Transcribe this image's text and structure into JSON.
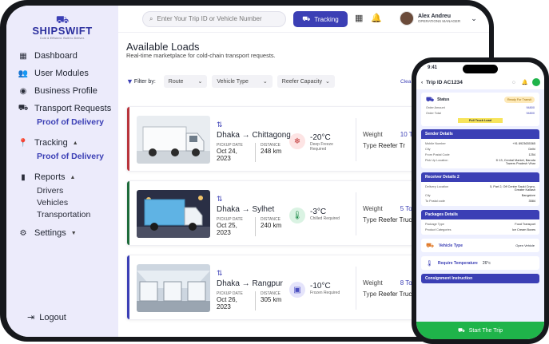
{
  "brand": {
    "name": "SHIPSWIFT",
    "tagline": "Cold & Efficient. Built to Deliver."
  },
  "sidebar": {
    "items": [
      {
        "label": "Dashboard"
      },
      {
        "label": "User Modules"
      },
      {
        "label": "Business Profile"
      },
      {
        "label": "Transport Requests"
      },
      {
        "label": "Tracking"
      },
      {
        "label": "Reports"
      },
      {
        "label": "Settings"
      }
    ],
    "transport_sub": "Proof of Delivery",
    "tracking_sub": "Proof of Delivery",
    "reports_subs": [
      "Drivers",
      "Vehicles",
      "Transportation"
    ],
    "logout": "Logout"
  },
  "header": {
    "search_placeholder": "Enter Your Trip ID or Vehicle Number",
    "tracking_label": "Tracking",
    "user_name": "Alex Andreu",
    "user_role": "OPERATIONS MANAGER"
  },
  "page": {
    "title": "Available Loads",
    "subtitle": "Real-time marketplace for cold-chain transport requests."
  },
  "filters": {
    "label": "Filter by:",
    "route": "Route",
    "vehicle_type": "Vehicle Type",
    "reefer": "Reefer Capacity",
    "clear": "Clea"
  },
  "loads": [
    {
      "from": "Dhaka",
      "to": "Chittagong",
      "pickup_label": "PICKUP DATE",
      "pickup": "Oct 24, 2023",
      "distance_label": "DISTANCE",
      "distance": "248 km",
      "temp": "-20°C",
      "temp_label": "Deep Freeze Required",
      "weight_label": "Weight",
      "weight": "10 T",
      "type_label": "Type",
      "type": "Reefer Tr",
      "accent": "#b8343b",
      "temp_bg": "#fde4e4",
      "temp_color": "#c23a3a",
      "icon": "snowflake-icon"
    },
    {
      "from": "Dhaka",
      "to": "Sylhet",
      "pickup_label": "PICKUP DATE",
      "pickup": "Oct 25, 2023",
      "distance_label": "DISTANCE",
      "distance": "240 km",
      "temp": "-3°C",
      "temp_label": "Chilled Required",
      "weight_label": "Weight",
      "weight": "5 To",
      "type_label": "Type",
      "type": "Reefer Truck",
      "accent": "#1d6b3a",
      "temp_bg": "#daf3e3",
      "temp_color": "#1f8d4a",
      "icon": "thermometer-icon"
    },
    {
      "from": "Dhaka",
      "to": "Rangpur",
      "pickup_label": "PICKUP DATE",
      "pickup": "Oct 26, 2023",
      "distance_label": "DISTANCE",
      "distance": "305 km",
      "temp": "-10°C",
      "temp_label": "Frozen Required",
      "weight_label": "Weight",
      "weight": "8 To",
      "type_label": "Type",
      "type": "Reefer Truck",
      "accent": "#3b3fb5",
      "temp_bg": "#e5e4fb",
      "temp_color": "#4a4ec0",
      "icon": "freezer-icon"
    }
  ],
  "phone": {
    "time": "9:41",
    "trip": "Trip ID AC1234",
    "status_label": "Status",
    "status_value": "Ready For Transit",
    "order_amount_label": "Order Amount",
    "order_amount": "94800",
    "order_total_label": "Order Total",
    "order_total": "94800",
    "full_truck": "Full Truck Load",
    "sender": {
      "title": "Sender Details",
      "rows": [
        [
          "Mobile Number",
          "+91 8923635365"
        ],
        [
          "City",
          "Delhi"
        ],
        [
          "From Postal Code",
          "1254"
        ],
        [
          "Pick Up Location",
          "D 13, Central Market, Baroda Towers Pradesh Vihar"
        ]
      ]
    },
    "receiver": {
      "title": "Receiver Details 2",
      "rows": [
        [
          "Delivery Location",
          "5, Part 2, Off Centre Sauki Cnpro, Greater Kailash"
        ],
        [
          "City",
          "Bangalore"
        ],
        [
          "To Postal code",
          "3584"
        ]
      ]
    },
    "packages": {
      "title": "Packages Details",
      "rows": [
        [
          "Package Type",
          "Food Transport"
        ],
        [
          "Product Categories",
          "Ice Cream Boxes"
        ]
      ]
    },
    "vehicle_type_label": "Vehicle Type",
    "vehicle_type": "Open Vehicle",
    "temp_label": "Require Temperature",
    "temp": "26°c",
    "consignment": "Consignment Instruction",
    "start": "Start The Trip"
  }
}
